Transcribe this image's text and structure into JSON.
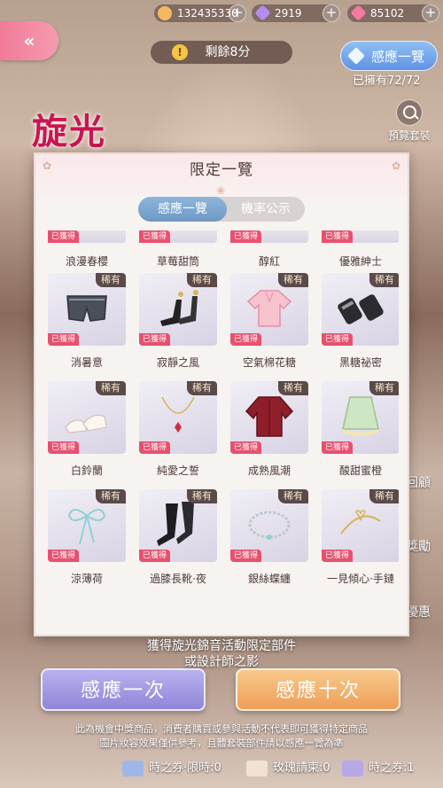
{
  "topbar": {
    "currencies": [
      {
        "icon": "cat-coin-icon",
        "value": "132435330",
        "color": "#f4b860"
      },
      {
        "icon": "purple-diamond-icon",
        "value": "2919",
        "color": "#b48cf0"
      },
      {
        "icon": "pink-diamond-icon",
        "value": "85102",
        "color": "#f37aa0"
      }
    ],
    "plus": "+"
  },
  "back_button": {
    "glyph": "«"
  },
  "timer": {
    "icon": "!",
    "text": "剩餘8分"
  },
  "induction_button": {
    "label": "感應一覽"
  },
  "owned": "已擁有72/72",
  "preview": {
    "label": "預覽套裝"
  },
  "logo": "旋光",
  "modal": {
    "title": "限定一覽",
    "tabs": [
      {
        "label": "感應一覽",
        "active": true
      },
      {
        "label": "機率公示",
        "active": false
      }
    ],
    "got_label": "已獲得",
    "rare_label": "稀有",
    "top_row_names": [
      "浪漫春櫻",
      "草莓甜筒",
      "醇紅",
      "優雅紳士"
    ],
    "rows": [
      {
        "items": [
          {
            "name": "消暑意",
            "art": "shorts"
          },
          {
            "name": "寂靜之風",
            "art": "boots"
          },
          {
            "name": "空氣棉花糖",
            "art": "blouse"
          },
          {
            "name": "黑糖祕密",
            "art": "gloves"
          }
        ]
      },
      {
        "items": [
          {
            "name": "白鈴蘭",
            "art": "heels"
          },
          {
            "name": "純愛之誓",
            "art": "necklace"
          },
          {
            "name": "成熟風潮",
            "art": "jacket"
          },
          {
            "name": "酸甜蜜橙",
            "art": "skirt"
          }
        ]
      },
      {
        "items": [
          {
            "name": "涼薄荷",
            "art": "ribbon"
          },
          {
            "name": "過膝長靴·夜",
            "art": "longboots"
          },
          {
            "name": "銀絲蝶纏",
            "art": "choker"
          },
          {
            "name": "一見傾心·手鏈",
            "art": "bracelet"
          }
        ]
      }
    ]
  },
  "under_modal_text": [
    "獲得旋光錦音活動限定部件",
    "或設計師之影"
  ],
  "side_labels": [
    "回顧",
    "獎勵",
    "優惠"
  ],
  "buttons": {
    "once": "感應一次",
    "ten": "感應十次"
  },
  "disclaimer": [
    "此為機會中獎商品，消費者購買或參與活動不代表即可獲得特定商品",
    "圖片妝容效果僅供參考，且體套裝部件請以感應一覽為準"
  ],
  "tickets": [
    {
      "label": "時之券·限時:0",
      "icon": "time-ticket-limited-icon",
      "color": "#9fb7e8"
    },
    {
      "label": "玫瑰請柬:0",
      "icon": "rose-invitation-icon",
      "color": "#f1e3d3"
    },
    {
      "label": "時之券:1",
      "icon": "time-ticket-icon",
      "color": "#b7a8e8"
    }
  ]
}
